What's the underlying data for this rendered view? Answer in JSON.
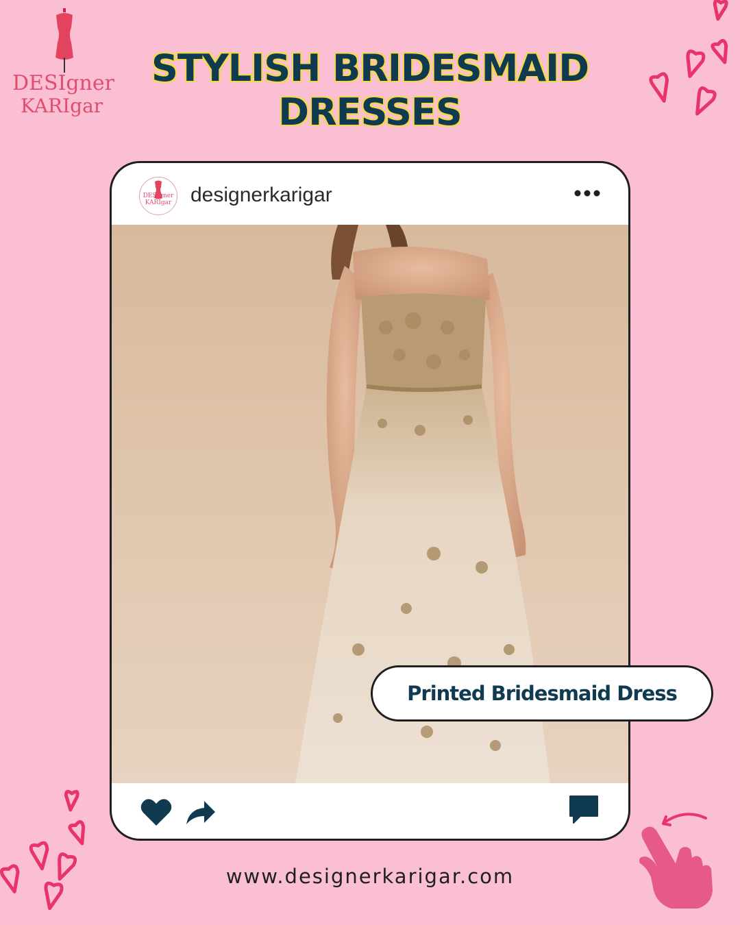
{
  "brand": {
    "logo_line1": "DESIgner",
    "logo_line2": "KARIgar",
    "accent": "#e04d6e"
  },
  "headline": {
    "line1": "STYLISH BRIDESMAID",
    "line2": "DRESSES",
    "color": "#0f3a4f",
    "outline": "#f2d84a"
  },
  "post": {
    "username": "designerkarigar",
    "avatar_line1": "DESIgner",
    "avatar_line2": "KARIgar",
    "icons": [
      "more-icon",
      "heart-icon",
      "share-icon",
      "comment-icon"
    ]
  },
  "caption": "Printed Bridesmaid Dress",
  "website": "www.designerkarigar.com",
  "colors": {
    "background": "#fbbfd3",
    "heart": "#e8336b",
    "navy": "#0f3a4f"
  }
}
